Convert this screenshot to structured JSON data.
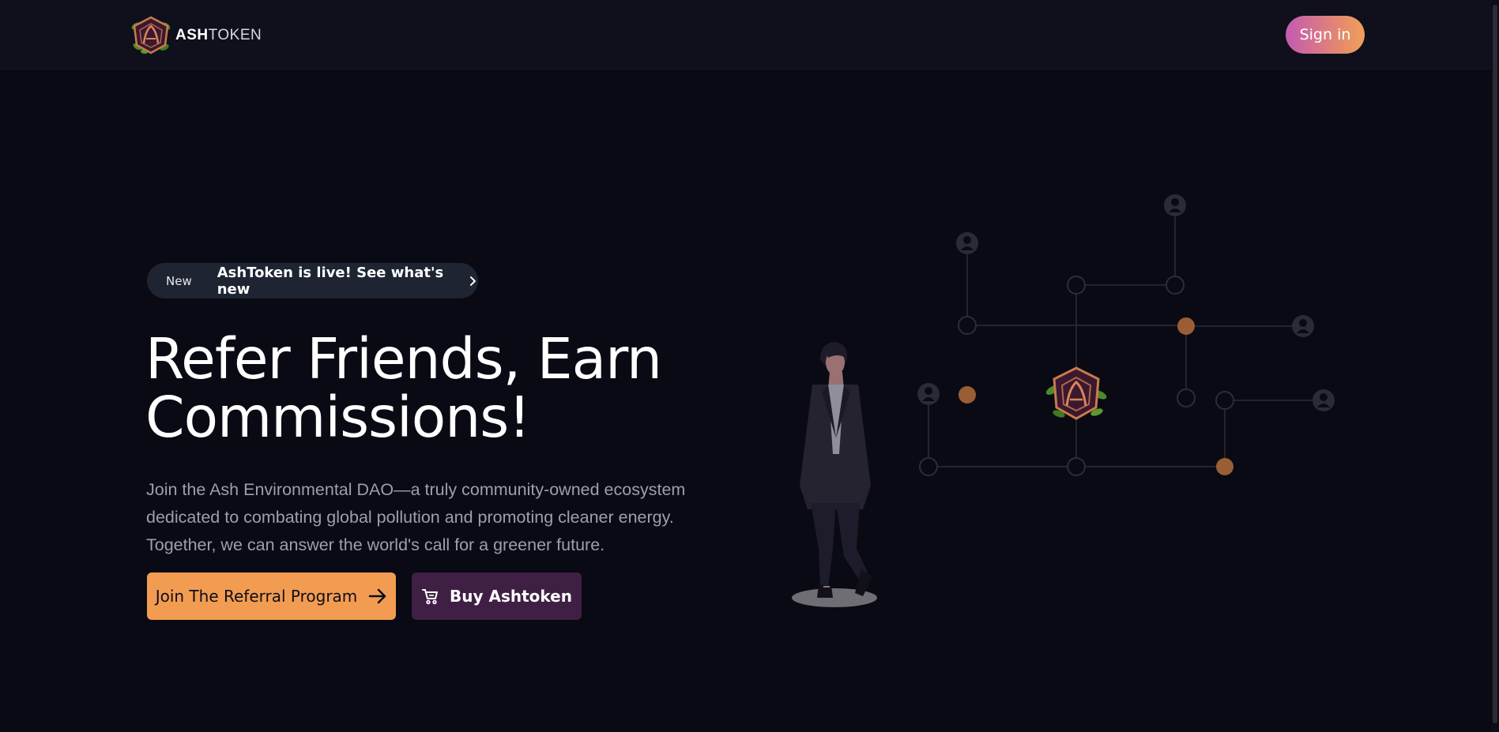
{
  "header": {
    "brand_bold": "ASH",
    "brand_light": "TOKEN",
    "signin_label": "Sign in",
    "logo_icon": "ashtoken-logo-icon"
  },
  "announcement": {
    "tag": "New",
    "text": "AshToken is live! See what's new",
    "icon": "chevron-right-icon"
  },
  "hero": {
    "title_line1": "Refer Friends, Earn",
    "title_line2": "Commissions!",
    "description": "Join the Ash Environmental DAO—a truly community-owned ecosystem dedicated to combating global pollution and promoting cleaner energy. Together, we can answer the world's call for a greener future.",
    "primary_cta": "Join The Referral Program",
    "primary_cta_icon": "arrow-right-icon",
    "secondary_cta": "Buy Ashtoken",
    "secondary_cta_icon": "cart-icon"
  },
  "colors": {
    "background": "#090a14",
    "header_bg": "#0f101b",
    "primary_orange": "#f29c52",
    "secondary_purple": "#3f2044",
    "gradient_start": "#c45ab3",
    "gradient_end": "#f2a05a",
    "network_node_active": "#9a5e35",
    "network_line": "#2c2d37"
  }
}
